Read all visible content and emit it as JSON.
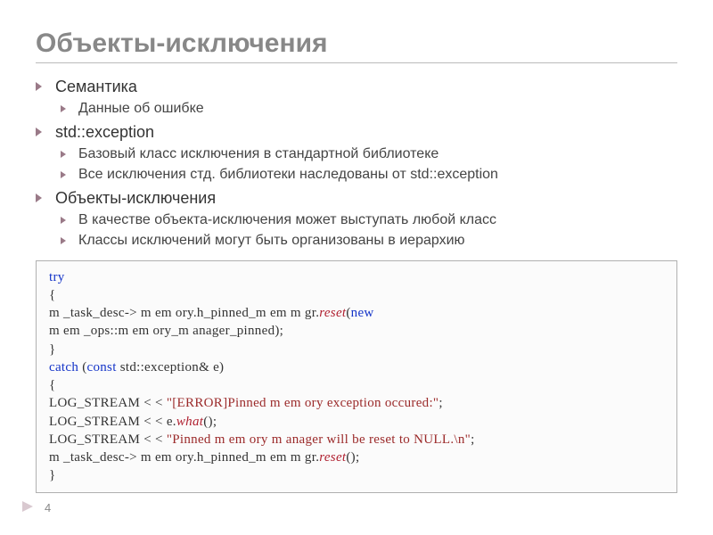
{
  "title": "Объекты-исключения",
  "bullets": {
    "b0": "Семантика",
    "b0_0": "Данные об ошибке",
    "b1": "std::exception",
    "b1_0": "Базовый класс исключения в стандартной библиотеке",
    "b1_1": "Все исключения стд. библиотеки наследованы от std::exception",
    "b2": "Объекты-исключения",
    "b2_0": "В качестве объекта-исключения может выступать любой класс",
    "b2_1": "Классы исключений могут быть организованы в иерархию"
  },
  "code": {
    "l1_kw": "try",
    "l2": "{",
    "l3_a": "   m _task_desc-> m em ory.h_pinned_m em m gr.",
    "l3_fn": "reset",
    "l3_b": "(",
    "l3_kw": "new",
    "l4": "m em _ops::m em ory_m anager_pinned);",
    "l5": "}",
    "l6_kw1": "catch",
    "l6_a": " (",
    "l6_kw2": "const",
    "l6_b": " std::exception& e)",
    "l7": "{",
    "l8_a": "   LOG_STREAM < < ",
    "l8_str": "\"[ERROR]Pinned m em ory exception occured:\"",
    "l8_b": ";",
    "l9_a": "   LOG_STREAM < < e.",
    "l9_fn": "what",
    "l9_b": "();",
    "l10_a": "   LOG_STREAM < < ",
    "l10_str": "\"Pinned m em ory m anager will be reset to NULL.\\n\"",
    "l10_b": ";",
    "l11_a": "   m _task_desc-> m em ory.h_pinned_m em m gr.",
    "l11_fn": "reset",
    "l11_b": "();",
    "l12": "}"
  },
  "pagenum": "4"
}
